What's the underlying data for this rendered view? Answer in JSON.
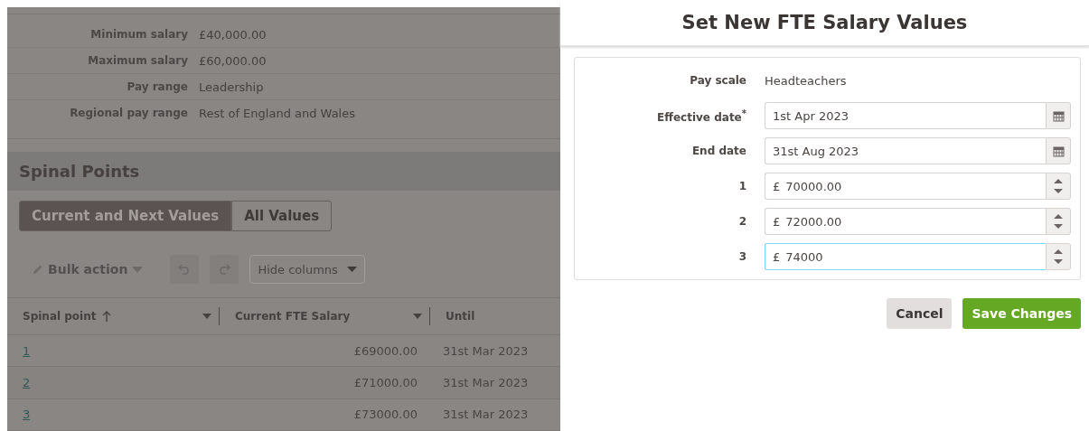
{
  "details": [
    {
      "label": "Minimum salary",
      "value": "£40,000.00"
    },
    {
      "label": "Maximum salary",
      "value": "£60,000.00"
    },
    {
      "label": "Pay range",
      "value": "Leadership"
    },
    {
      "label": "Regional pay range",
      "value": "Rest of England and Wales"
    }
  ],
  "section_title": "Spinal Points",
  "view_tabs": [
    {
      "label": "Current and Next Values",
      "selected": true
    },
    {
      "label": "All Values",
      "selected": false
    }
  ],
  "toolbar": {
    "bulk_action": "Bulk action",
    "hide_columns": "Hide columns"
  },
  "table": {
    "columns": [
      {
        "label": "Spinal point",
        "sorted": true
      },
      {
        "label": "Current FTE Salary",
        "sorted": false
      },
      {
        "label": "Until",
        "sorted": false
      }
    ],
    "rows": [
      [
        "1",
        "£69000.00",
        "31st Mar 2023"
      ],
      [
        "2",
        "£71000.00",
        "31st Mar 2023"
      ],
      [
        "3",
        "£73000.00",
        "31st Mar 2023"
      ]
    ]
  },
  "modal": {
    "title": "Set New FTE Salary Values",
    "fields": [
      {
        "kind": "text",
        "label": "Pay scale",
        "value": "Headteachers"
      },
      {
        "kind": "date",
        "label": "Effective date$^{*}$",
        "value": "1st Apr 2023",
        "focused": false
      },
      {
        "kind": "date",
        "label": "End date",
        "value": "31st Aug 2023",
        "focused": false
      },
      {
        "kind": "currency",
        "label": "1",
        "prefix": "£",
        "value": "70000.00",
        "focused": false
      },
      {
        "kind": "currency",
        "label": "2",
        "prefix": "£",
        "value": "72000.00",
        "focused": false
      },
      {
        "kind": "currency",
        "label": "3",
        "prefix": "£",
        "value": "74000",
        "focused": true
      }
    ],
    "buttons": [
      {
        "kind": "secondary",
        "label": "Cancel"
      },
      {
        "kind": "primary",
        "label": "Save Changes"
      }
    ]
  }
}
